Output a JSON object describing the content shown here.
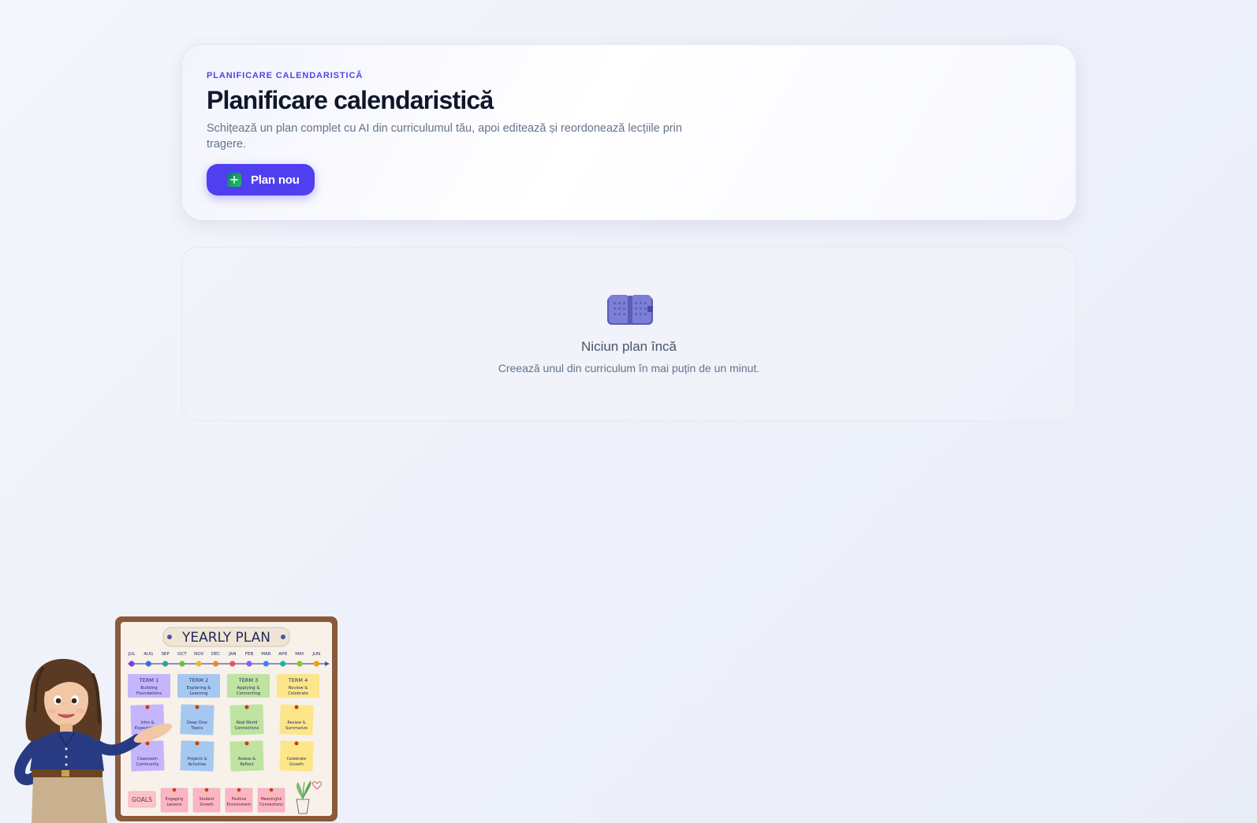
{
  "header": {
    "eyebrow": "PLANIFICARE CALENDARISTICĂ",
    "title": "Planificare calendaristică",
    "subtitle": "Schițează un plan complet cu AI din curriculumul tău, apoi editează și reordonează lecțiile prin tragere.",
    "new_plan_label": "Plan nou",
    "new_plan_icon": "plus-square-icon"
  },
  "empty_state": {
    "icon": "book-icon",
    "title": "Niciun plan încă",
    "subtitle": "Creează unul din curriculum în mai puțin de un minut."
  },
  "illustration": {
    "board_title": "YEARLY PLAN",
    "months": [
      "JUL",
      "AUG",
      "SEP",
      "OCT",
      "NOV",
      "DEC",
      "JAN",
      "FEB",
      "MAR",
      "APR",
      "MAY",
      "JUN"
    ],
    "terms": [
      {
        "label": "TERM 1",
        "sub1": "Building",
        "sub2": "Foundations",
        "color": "#c4b5fd"
      },
      {
        "label": "TERM 2",
        "sub1": "Exploring &",
        "sub2": "Learning",
        "color": "#a5c8f0"
      },
      {
        "label": "TERM 3",
        "sub1": "Applying &",
        "sub2": "Connecting",
        "color": "#bfe3a0"
      },
      {
        "label": "TERM 4",
        "sub1": "Review &",
        "sub2": "Celebrate",
        "color": "#fde68a"
      }
    ],
    "notes_row1": [
      {
        "l1": "Intro &",
        "l2": "Expectations"
      },
      {
        "l1": "Deep Dive",
        "l2": "Topics"
      },
      {
        "l1": "Real World",
        "l2": "Connections"
      },
      {
        "l1": "Review &",
        "l2": "Summarize"
      }
    ],
    "notes_row2": [
      {
        "l1": "Classroom",
        "l2": "Community"
      },
      {
        "l1": "Projects &",
        "l2": "Activities"
      },
      {
        "l1": "Assess &",
        "l2": "Reflect"
      },
      {
        "l1": "Celebrate",
        "l2": "Growth"
      }
    ],
    "goals_label": "GOALS",
    "goals": [
      {
        "l1": "Engaging",
        "l2": "Lessons"
      },
      {
        "l1": "Student",
        "l2": "Growth"
      },
      {
        "l1": "Positive",
        "l2": "Environment"
      },
      {
        "l1": "Meaningful",
        "l2": "Connections"
      }
    ]
  },
  "colors": {
    "accent": "#4f3ff0",
    "eyebrow": "#4f46e5",
    "title": "#0f172a",
    "muted": "#64748b"
  }
}
